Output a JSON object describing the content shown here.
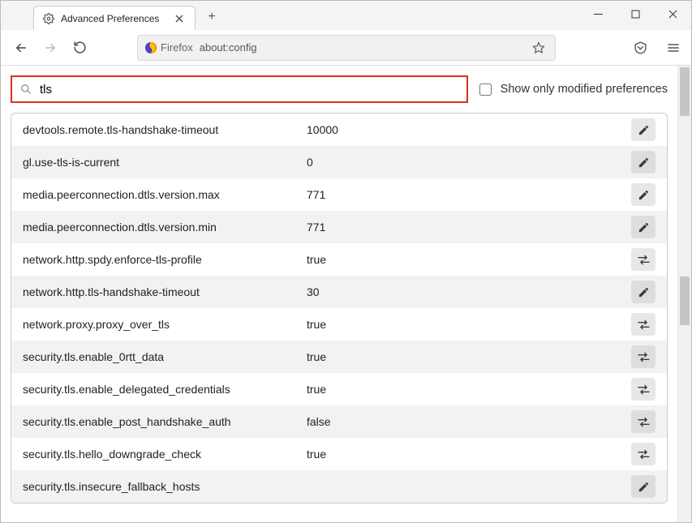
{
  "window": {
    "tab_title": "Advanced Preferences",
    "new_tab_label": "+"
  },
  "toolbar": {
    "firefox_label": "Firefox",
    "url_text": "about:config"
  },
  "search": {
    "value": "tls",
    "placeholder": ""
  },
  "show_modified": {
    "label": "Show only modified preferences",
    "checked": false
  },
  "prefs": [
    {
      "name": "devtools.remote.tls-handshake-timeout",
      "value": "10000",
      "action": "edit"
    },
    {
      "name": "gl.use-tls-is-current",
      "value": "0",
      "action": "edit"
    },
    {
      "name": "media.peerconnection.dtls.version.max",
      "value": "771",
      "action": "edit"
    },
    {
      "name": "media.peerconnection.dtls.version.min",
      "value": "771",
      "action": "edit"
    },
    {
      "name": "network.http.spdy.enforce-tls-profile",
      "value": "true",
      "action": "toggle"
    },
    {
      "name": "network.http.tls-handshake-timeout",
      "value": "30",
      "action": "edit"
    },
    {
      "name": "network.proxy.proxy_over_tls",
      "value": "true",
      "action": "toggle"
    },
    {
      "name": "security.tls.enable_0rtt_data",
      "value": "true",
      "action": "toggle"
    },
    {
      "name": "security.tls.enable_delegated_credentials",
      "value": "true",
      "action": "toggle"
    },
    {
      "name": "security.tls.enable_post_handshake_auth",
      "value": "false",
      "action": "toggle"
    },
    {
      "name": "security.tls.hello_downgrade_check",
      "value": "true",
      "action": "toggle"
    },
    {
      "name": "security.tls.insecure_fallback_hosts",
      "value": "",
      "action": "edit"
    }
  ]
}
